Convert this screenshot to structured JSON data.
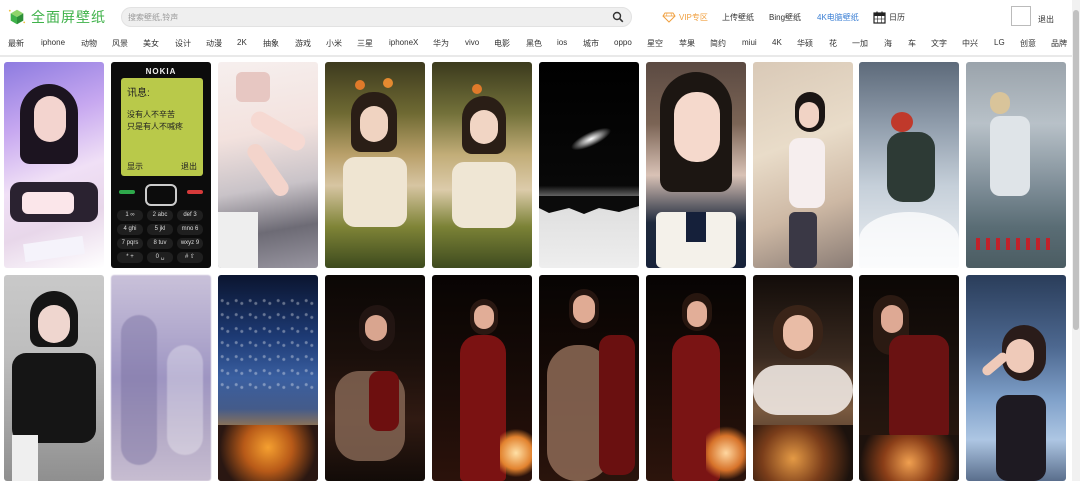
{
  "header": {
    "logo_text": "全面屏壁纸",
    "search_placeholder": "搜索壁纸,铃声",
    "vip_label": "VIP专区",
    "upload_label": "上传壁纸",
    "bing_label": "Bing壁纸",
    "k4_label": "4K电脑壁纸",
    "calendar_label": "日历",
    "logout_label": "退出"
  },
  "categories": [
    "最新",
    "iphone",
    "动物",
    "风景",
    "美女",
    "设计",
    "动漫",
    "2K",
    "抽象",
    "游戏",
    "小米",
    "三星",
    "iphoneX",
    "华为",
    "vivo",
    "电影",
    "黑色",
    "ios",
    "城市",
    "oppo",
    "星空",
    "苹果",
    "简约",
    "miui",
    "4K",
    "华硕",
    "花",
    "一加",
    "海",
    "车",
    "文字",
    "中兴",
    "LG",
    "创意",
    "品牌"
  ],
  "phone_tile": {
    "brand": "NOKIA",
    "title": "讯息:",
    "line1": "没有人不辛苦",
    "line2": "只是有人不喊疼",
    "left_soft": "显示",
    "right_soft": "退出",
    "keys": [
      "1 ∞",
      "2 abc",
      "def 3",
      "4 ghi",
      "5 jkl",
      "mno 6",
      "7 pqrs",
      "8 tuv",
      "wxyz 9",
      "* +",
      "0 ␣",
      "# ⇧"
    ]
  },
  "colors": {
    "logo_green": "#3fb24a",
    "vip_orange": "#f0a040",
    "link_blue": "#3b7fd4"
  }
}
